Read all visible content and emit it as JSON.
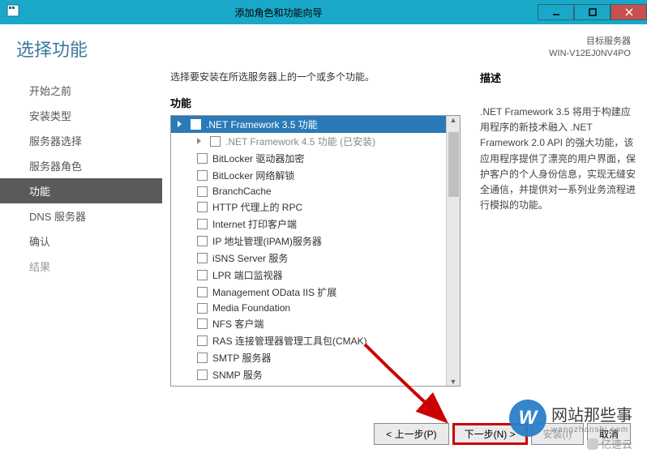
{
  "titlebar": {
    "title": "添加角色和功能向导"
  },
  "header": {
    "page_title": "选择功能",
    "target_label": "目标服务器",
    "target_value": "WIN-V12EJ0NV4PO"
  },
  "nav": {
    "items": [
      {
        "label": "开始之前",
        "selected": false
      },
      {
        "label": "安装类型",
        "selected": false
      },
      {
        "label": "服务器选择",
        "selected": false
      },
      {
        "label": "服务器角色",
        "selected": false
      },
      {
        "label": "功能",
        "selected": true
      },
      {
        "label": "DNS 服务器",
        "selected": false
      },
      {
        "label": "确认",
        "selected": false
      },
      {
        "label": "结果",
        "selected": false,
        "dim": true
      }
    ]
  },
  "main": {
    "instruction": "选择要安装在所选服务器上的一个或多个功能。",
    "features_label": "功能",
    "items": [
      {
        "label": ".NET Framework 3.5 功能",
        "selected": true,
        "expandable": true
      },
      {
        "label": ".NET Framework 4.5 功能 (已安装)",
        "installed": true,
        "expandable": true,
        "child": true
      },
      {
        "label": "BitLocker 驱动器加密",
        "child": true
      },
      {
        "label": "BitLocker 网络解锁",
        "child": true
      },
      {
        "label": "BranchCache",
        "child": true
      },
      {
        "label": "HTTP 代理上的 RPC",
        "child": true
      },
      {
        "label": "Internet 打印客户端",
        "child": true
      },
      {
        "label": "IP 地址管理(IPAM)服务器",
        "child": true
      },
      {
        "label": "iSNS Server 服务",
        "child": true
      },
      {
        "label": "LPR 端口监视器",
        "child": true
      },
      {
        "label": "Management OData IIS 扩展",
        "child": true
      },
      {
        "label": "Media Foundation",
        "child": true
      },
      {
        "label": "NFS 客户端",
        "child": true
      },
      {
        "label": "RAS 连接管理器管理工具包(CMAK)",
        "child": true
      },
      {
        "label": "SMTP 服务器",
        "child": true
      },
      {
        "label": "SNMP 服务",
        "child": true
      }
    ]
  },
  "desc": {
    "label": "描述",
    "text": ".NET Framework 3.5 将用于构建应用程序的新技术融入 .NET Framework 2.0 API 的强大功能，该应用程序提供了漂亮的用户界面，保护客户的个人身份信息，实现无缝安全通信，并提供对一系列业务流程进行模拟的功能。"
  },
  "footer": {
    "prev": "< 上一步(P)",
    "next": "下一步(N) >",
    "install": "安装(I)",
    "cancel": "取消"
  },
  "watermark": {
    "letter": "W",
    "text": "网站那些事",
    "sub": "wangzhanshi.com",
    "yk": "亿速云"
  }
}
